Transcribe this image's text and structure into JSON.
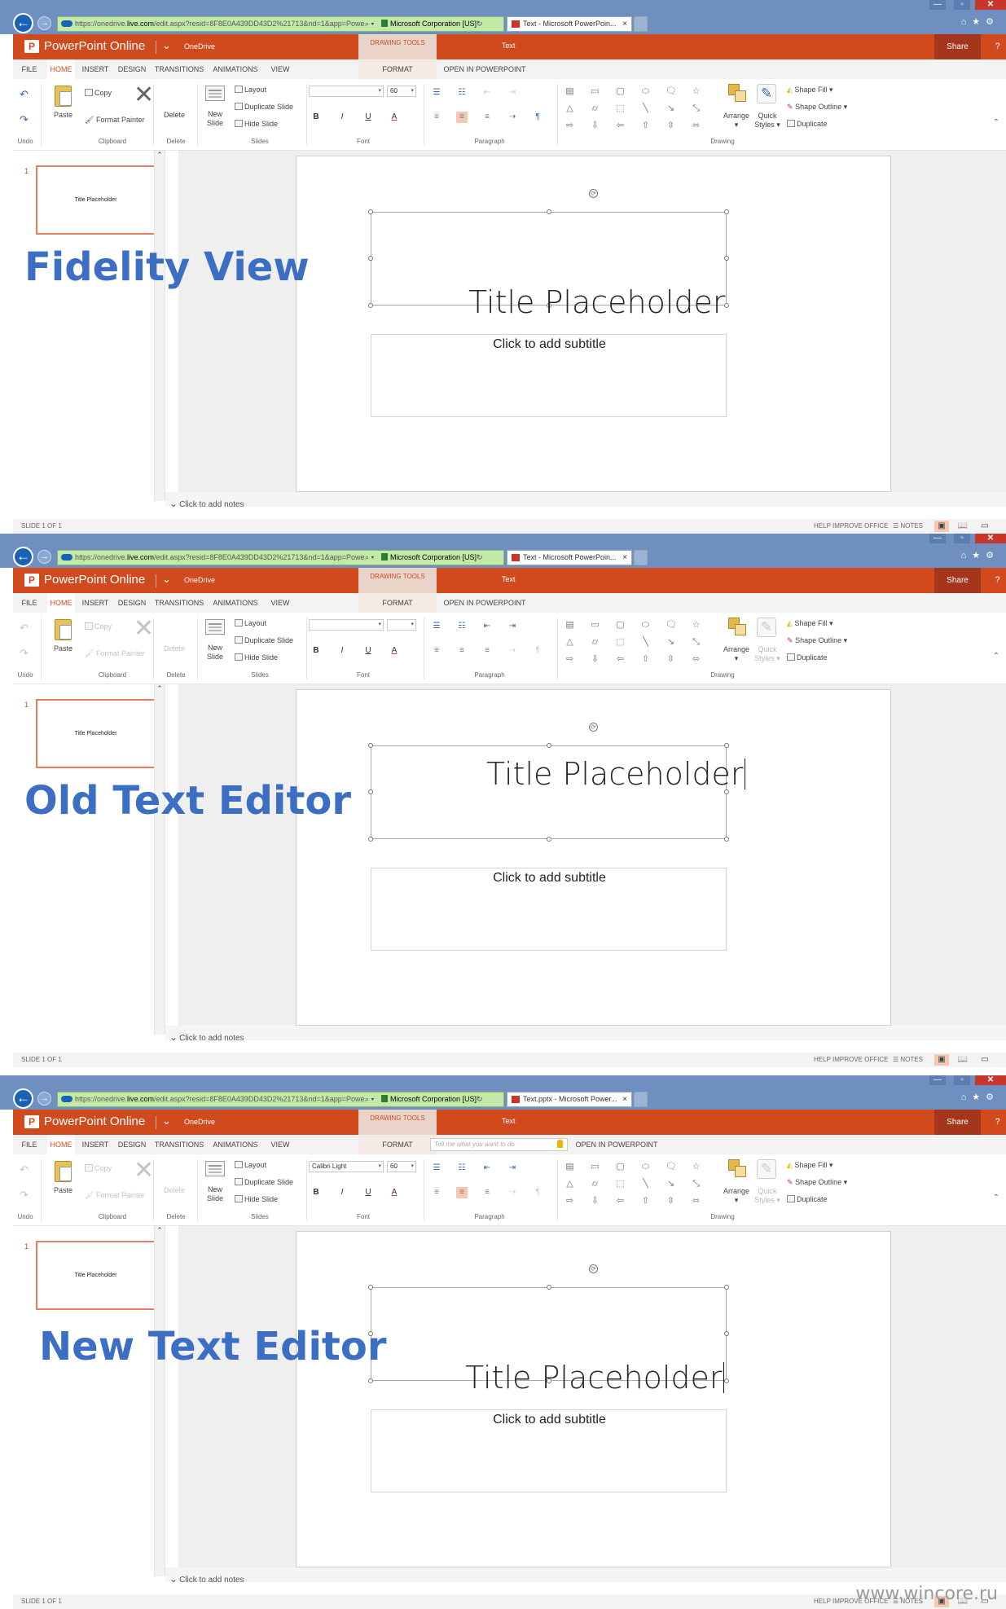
{
  "browser": {
    "url_plain": "https://onedrive.",
    "url_bold": "live.com",
    "url_rest": "/edit.aspx?resid=8F8E0A439DD43D2%21713&nd=1&app=PowerI",
    "site_identity": "Microsoft Corporation [US]",
    "back_glyph": "←",
    "forward_glyph": "→",
    "tab_close": "×",
    "icons": [
      "home-icon",
      "star-icon",
      "gear-icon"
    ]
  },
  "app": {
    "name": "PowerPoint Online",
    "location": "OneDrive",
    "drawing_tools": "DRAWING TOOLS",
    "contextual_title": "Text",
    "share": "Share",
    "help": "?",
    "accent_color": "#d04a1e"
  },
  "tabs": [
    "FILE",
    "HOME",
    "INSERT",
    "DESIGN",
    "TRANSITIONS",
    "ANIMATIONS",
    "VIEW",
    "FORMAT",
    "OPEN IN POWERPOINT"
  ],
  "ribbon": {
    "undo": "Undo",
    "clipboard": {
      "group": "Clipboard",
      "paste": "Paste",
      "copy": "Copy",
      "format_painter": "Format Painter"
    },
    "delete": {
      "group": "Delete",
      "label": "Delete"
    },
    "slides": {
      "group": "Slides",
      "new_slide_1": "New",
      "new_slide_2": "Slide",
      "layout": "Layout",
      "duplicate_slide": "Duplicate Slide",
      "hide_slide": "Hide Slide"
    },
    "font": {
      "group": "Font",
      "bold": "B",
      "italic": "I",
      "underline": "U",
      "color": "A"
    },
    "paragraph": {
      "group": "Paragraph"
    },
    "drawing": {
      "group": "Drawing",
      "arrange": "Arrange",
      "quick_1": "Quick",
      "quick_2": "Styles",
      "shape_fill": "Shape Fill",
      "shape_outline": "Shape Outline",
      "duplicate": "Duplicate"
    }
  },
  "slide": {
    "number": "1",
    "thumb_title": "Title Placeholder",
    "title": "Title Placeholder",
    "subtitle": "Click to add subtitle",
    "notes": "Click to add notes"
  },
  "status": {
    "slide_count": "SLIDE 1 OF 1",
    "help": "HELP IMPROVE OFFICE",
    "notes": "NOTES"
  },
  "views": [
    {
      "caption": "Fidelity View",
      "tab_title": "Text - Microsoft PowerPoin...",
      "font_name": "",
      "font_size": "60",
      "tell_me": "",
      "editing": false
    },
    {
      "caption": "Old Text Editor",
      "tab_title": "Text - Microsoft PowerPoin...",
      "font_name": "",
      "font_size": "",
      "tell_me": "",
      "editing": true
    },
    {
      "caption": "New Text Editor",
      "tab_title": "Text.pptx - Microsoft Power...",
      "font_name": "Calibri Light",
      "font_size": "60",
      "tell_me": "Tell me what you want to do",
      "editing": true
    }
  ],
  "watermark": "www.wincore.ru",
  "caption_color": "#3c6fc4"
}
